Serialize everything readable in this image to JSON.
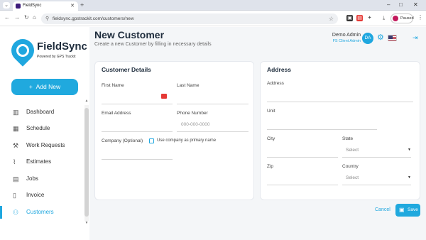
{
  "browser": {
    "tab_title": "FieldSync",
    "url": "fieldsync.gpstrackit.com/customers/new",
    "profile_status": "Paused"
  },
  "sidebar": {
    "logo_name": "FieldSync",
    "logo_sub": "Powered by GPS Trackit",
    "add_new_label": "Add New",
    "items": [
      {
        "label": "Dashboard",
        "icon": "bar-chart-icon"
      },
      {
        "label": "Schedule",
        "icon": "calendar-icon"
      },
      {
        "label": "Work Requests",
        "icon": "wrench-icon"
      },
      {
        "label": "Estimates",
        "icon": "paperclip-icon"
      },
      {
        "label": "Jobs",
        "icon": "clipboard-icon"
      },
      {
        "label": "Invoice",
        "icon": "document-icon"
      },
      {
        "label": "Customers",
        "icon": "users-icon",
        "active": true
      }
    ]
  },
  "header": {
    "title": "New Customer",
    "subtitle": "Create a new Customer by filling in necessary details",
    "user_name": "Demo Admin",
    "user_role": "FS Client Admin",
    "avatar_initials": "DA"
  },
  "customer_details": {
    "title": "Customer Details",
    "first_name_label": "First Name",
    "last_name_label": "Last Name",
    "email_label": "Email Address",
    "phone_label": "Phone Number",
    "phone_placeholder": "000-000-0000",
    "company_label": "Company (Optional)",
    "use_company_label": "Use company as primary name"
  },
  "address": {
    "title": "Address",
    "address_label": "Address",
    "unit_label": "Unit",
    "city_label": "City",
    "state_label": "State",
    "state_value": "Select",
    "zip_label": "Zip",
    "country_label": "Country",
    "country_value": "Select"
  },
  "actions": {
    "cancel_label": "Cancel",
    "save_label": "Save"
  },
  "colors": {
    "accent": "#20a9de",
    "title": "#1f2d3d"
  }
}
